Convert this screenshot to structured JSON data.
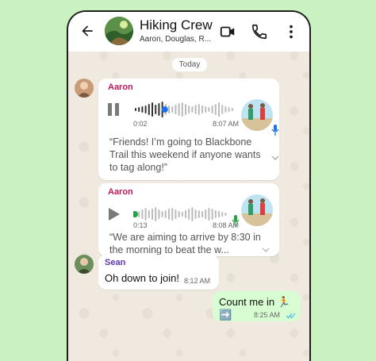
{
  "header": {
    "title": "Hiking Crew",
    "subtitle": "Aaron, Douglas, R...",
    "icons": [
      "back-arrow-icon",
      "video-call-icon",
      "phone-call-icon",
      "more-options-icon"
    ]
  },
  "date_separator": "Today",
  "messages": [
    {
      "sender": "Aaron",
      "sender_color": "#c2185b",
      "voice": {
        "state": "playing",
        "elapsed": "0:02",
        "time": "8:07 AM"
      },
      "transcript": "“Friends! I’m going to Blackbone Trail this weekend if anyone wants to tag along!”"
    },
    {
      "sender": "Aaron",
      "sender_color": "#c2185b",
      "voice": {
        "state": "paused",
        "elapsed": "0:13",
        "time": "8:08 AM"
      },
      "transcript": "“We are aiming to arrive by 8:30 in the morning to beat the w..."
    },
    {
      "sender": "Sean",
      "sender_color": "#5e35b1",
      "text": "Oh down to join!",
      "time": "8:12 AM"
    }
  ],
  "outgoing": {
    "text": "Count me in",
    "emoji": "🏃➡️",
    "time": "8:25 AM",
    "status": "read"
  },
  "colors": {
    "background": "#c9f2c0",
    "outgoing_bubble": "#d9fdd3",
    "accent_blue": "#1a73e8",
    "accent_green": "#25a244",
    "read_ticks": "#53bdeb"
  }
}
